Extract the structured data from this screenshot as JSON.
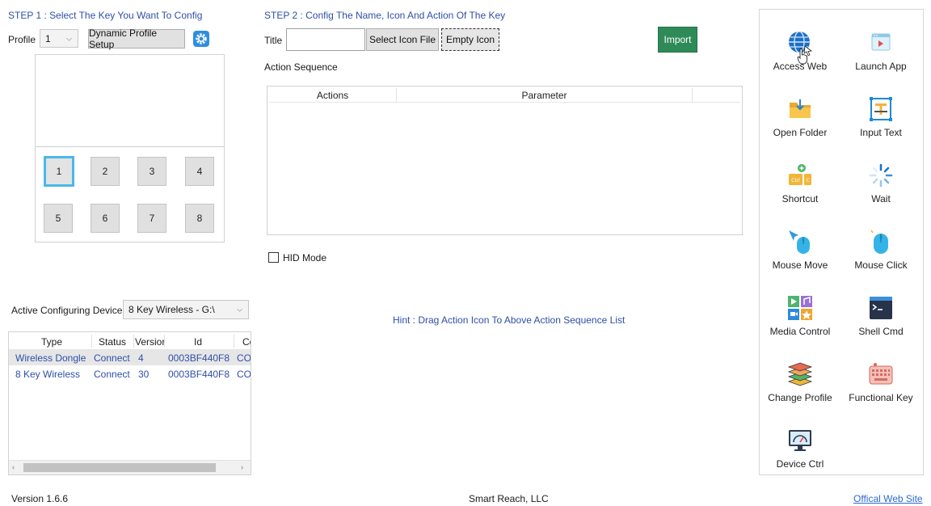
{
  "step1": {
    "title": "STEP 1 : Select The Key You Want To Config",
    "profile_label": "Profile",
    "profile_value": "1",
    "dynamic_profile_label": "Dynamic Profile Setup",
    "keys": [
      "1",
      "2",
      "3",
      "4",
      "5",
      "6",
      "7",
      "8"
    ],
    "selected_key": "1",
    "active_device_label": "Active Configuring Device",
    "active_device_value": "8 Key Wireless - G:\\"
  },
  "device_table": {
    "headers": [
      "Type",
      "Status",
      "Versior",
      "Id",
      "Co"
    ],
    "rows": [
      {
        "type": "Wireless Dongle",
        "status": "Connect",
        "version": "4",
        "id": "0003BF440F8",
        "co": "CO"
      },
      {
        "type": "8 Key Wireless",
        "status": "Connect",
        "version": "30",
        "id": "0003BF440F8",
        "co": "CO"
      }
    ]
  },
  "step2": {
    "title": "STEP 2 : Config The Name, Icon And Action Of The Key",
    "title_label": "Title",
    "title_value": "",
    "select_icon_label": "Select Icon File",
    "empty_icon_label": "Empty Icon",
    "import_label": "Import",
    "action_sequence_label": "Action Sequence",
    "columns": [
      "Actions",
      "Parameter"
    ],
    "hid_mode_label": "HID Mode",
    "hint": "Hint : Drag Action Icon To Above Action Sequence List"
  },
  "actions": [
    {
      "label": "Access Web",
      "icon": "globe-icon"
    },
    {
      "label": "Launch App",
      "icon": "app-window-icon"
    },
    {
      "label": "Open Folder",
      "icon": "folder-icon"
    },
    {
      "label": "Input Text",
      "icon": "text-input-icon"
    },
    {
      "label": "Shortcut",
      "icon": "keyboard-shortcut-icon"
    },
    {
      "label": "Wait",
      "icon": "spinner-icon"
    },
    {
      "label": "Mouse Move",
      "icon": "mouse-move-icon"
    },
    {
      "label": "Mouse Click",
      "icon": "mouse-click-icon"
    },
    {
      "label": "Media Control",
      "icon": "media-control-icon"
    },
    {
      "label": "Shell Cmd",
      "icon": "terminal-icon"
    },
    {
      "label": "Change Profile",
      "icon": "layers-icon"
    },
    {
      "label": "Functional Key",
      "icon": "function-key-icon"
    },
    {
      "label": "Device Ctrl",
      "icon": "monitor-icon"
    }
  ],
  "footer": {
    "version": "Version 1.6.6",
    "company": "Smart Reach, LLC",
    "website_link": "Offical Web Site"
  },
  "colors": {
    "step_title": "#2f4fa8",
    "import_green": "#2e8b57",
    "selected_key_border": "#4ab8e8",
    "row_selected": "#e6e6e6",
    "link": "#2b6ad1"
  }
}
